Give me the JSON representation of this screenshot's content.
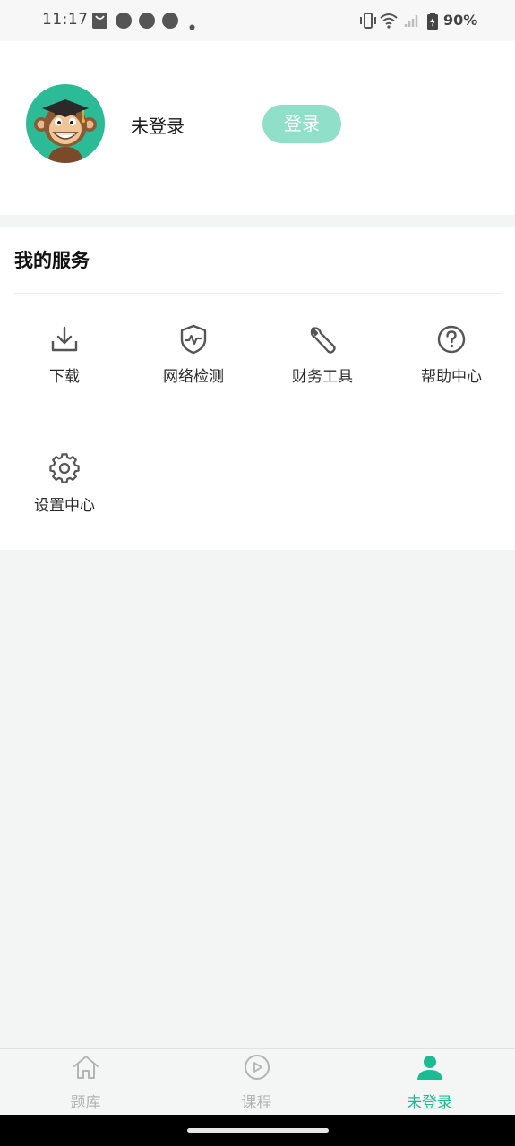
{
  "status_bar": {
    "time": "11:17",
    "battery": "90%",
    "icons": [
      "shopping-bag-icon",
      "compass-icon",
      "compass-icon",
      "compass-icon",
      "dot-icon",
      "vibrate-icon",
      "wifi-icon",
      "signal-icon",
      "battery-charging-icon"
    ]
  },
  "profile": {
    "name": "未登录",
    "login_label": "登录",
    "avatar_icon": "monkey-graduate-avatar"
  },
  "services": {
    "title": "我的服务",
    "items": [
      {
        "label": "下载",
        "icon": "download-icon"
      },
      {
        "label": "网络检测",
        "icon": "shield-pulse-icon"
      },
      {
        "label": "财务工具",
        "icon": "wrench-icon"
      },
      {
        "label": "帮助中心",
        "icon": "help-icon"
      },
      {
        "label": "设置中心",
        "icon": "gear-icon"
      }
    ]
  },
  "bottom_nav": {
    "items": [
      {
        "label": "题库",
        "icon": "home-icon",
        "active": false
      },
      {
        "label": "课程",
        "icon": "play-icon",
        "active": false
      },
      {
        "label": "未登录",
        "icon": "user-icon",
        "active": true
      }
    ]
  },
  "colors": {
    "accent": "#1dbb92",
    "login_button": "#8fdfc9",
    "avatar_bg": "#2bbb97",
    "page_bg": "#f3f5f5"
  }
}
